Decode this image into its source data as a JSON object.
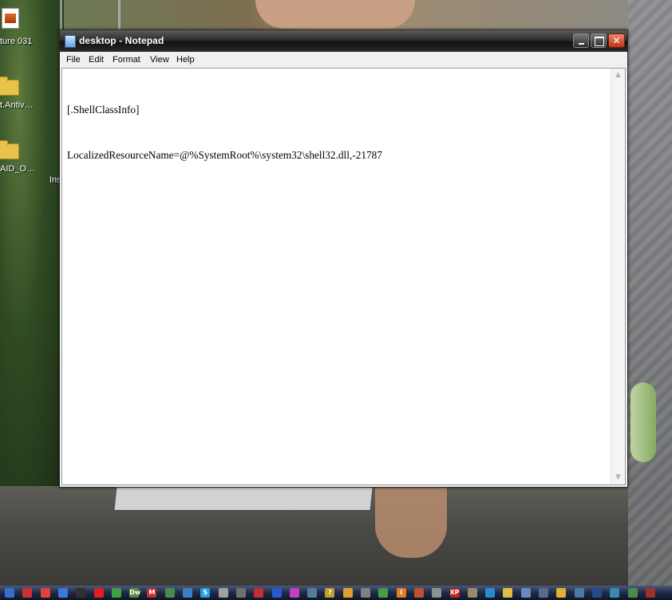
{
  "desktop": {
    "icons": [
      {
        "label": "ture 031",
        "icon": "image-file-icon"
      },
      {
        "label": "t.Antiv…",
        "icon": "folder-icon"
      },
      {
        "label": "AID_O…",
        "icon": "folder-icon"
      },
      {
        "label": "Ins",
        "icon": "partial-label"
      }
    ]
  },
  "window": {
    "title": "desktop - Notepad",
    "app_icon": "notepad-icon",
    "controls": {
      "minimize": "minimize-icon",
      "maximize": "maximize-icon",
      "close": "✕"
    },
    "menu": [
      "File",
      "Edit",
      "Format",
      "View",
      "Help"
    ],
    "content": {
      "lines": [
        "[.ShellClassInfo]",
        "LocalizedResourceName=@%SystemRoot%\\system32\\shell32.dll,-21787"
      ]
    },
    "scrollbar": {
      "up": "▲",
      "down": "▼"
    }
  },
  "taskbar": {
    "icons": [
      {
        "name": "app-1-icon",
        "glyph": "",
        "color": "#3a6cc8"
      },
      {
        "name": "app-2-icon",
        "glyph": "",
        "color": "#d03030"
      },
      {
        "name": "app-3-icon",
        "glyph": "",
        "color": "#e04040"
      },
      {
        "name": "app-4-icon",
        "glyph": "",
        "color": "#3a7ad8"
      },
      {
        "name": "app-5-icon",
        "glyph": "",
        "color": "#303030"
      },
      {
        "name": "app-6-icon",
        "glyph": "",
        "color": "#e02020"
      },
      {
        "name": "app-7-icon",
        "glyph": "",
        "color": "#40a040"
      },
      {
        "name": "dreamweaver-icon",
        "glyph": "Dw",
        "color": "#5a8a3a"
      },
      {
        "name": "gmail-icon",
        "glyph": "M",
        "color": "#c03030"
      },
      {
        "name": "app-10-icon",
        "glyph": "",
        "color": "#4a8a4a"
      },
      {
        "name": "app-11-icon",
        "glyph": "",
        "color": "#3a80c0"
      },
      {
        "name": "skype-icon",
        "glyph": "S",
        "color": "#2aa0e0"
      },
      {
        "name": "app-13-icon",
        "glyph": "",
        "color": "#a0a0a0"
      },
      {
        "name": "app-14-icon",
        "glyph": "",
        "color": "#707070"
      },
      {
        "name": "app-15-icon",
        "glyph": "",
        "color": "#c03030"
      },
      {
        "name": "app-16-icon",
        "glyph": "",
        "color": "#2a5ad0"
      },
      {
        "name": "app-17-icon",
        "glyph": "",
        "color": "#c040c0"
      },
      {
        "name": "app-18-icon",
        "glyph": "",
        "color": "#5a7a9a"
      },
      {
        "name": "app-19-icon",
        "glyph": "?",
        "color": "#c0a030"
      },
      {
        "name": "app-20-icon",
        "glyph": "",
        "color": "#e0a030"
      },
      {
        "name": "app-21-icon",
        "glyph": "",
        "color": "#808080"
      },
      {
        "name": "app-22-icon",
        "glyph": "",
        "color": "#4a9a4a"
      },
      {
        "name": "app-23-icon",
        "glyph": "i",
        "color": "#e08020"
      },
      {
        "name": "app-24-icon",
        "glyph": "",
        "color": "#c05030"
      },
      {
        "name": "app-25-icon",
        "glyph": "",
        "color": "#909090"
      },
      {
        "name": "xp-icon",
        "glyph": "XP",
        "color": "#c02020"
      },
      {
        "name": "app-27-icon",
        "glyph": "",
        "color": "#9a8a6a"
      },
      {
        "name": "app-28-icon",
        "glyph": "",
        "color": "#2a8ad0"
      },
      {
        "name": "app-29-icon",
        "glyph": "",
        "color": "#e0c040"
      },
      {
        "name": "app-30-icon",
        "glyph": "",
        "color": "#6a8ac0"
      },
      {
        "name": "app-31-icon",
        "glyph": "",
        "color": "#5a6a8a"
      },
      {
        "name": "app-32-icon",
        "glyph": "",
        "color": "#e0b030"
      },
      {
        "name": "app-33-icon",
        "glyph": "",
        "color": "#4a7aa0"
      },
      {
        "name": "app-34-icon",
        "glyph": "",
        "color": "#2a4a8a"
      },
      {
        "name": "app-35-icon",
        "glyph": "",
        "color": "#3a8ab0"
      },
      {
        "name": "app-36-icon",
        "glyph": "",
        "color": "#4a8a4a"
      },
      {
        "name": "app-37-icon",
        "glyph": "",
        "color": "#a03030"
      }
    ]
  }
}
